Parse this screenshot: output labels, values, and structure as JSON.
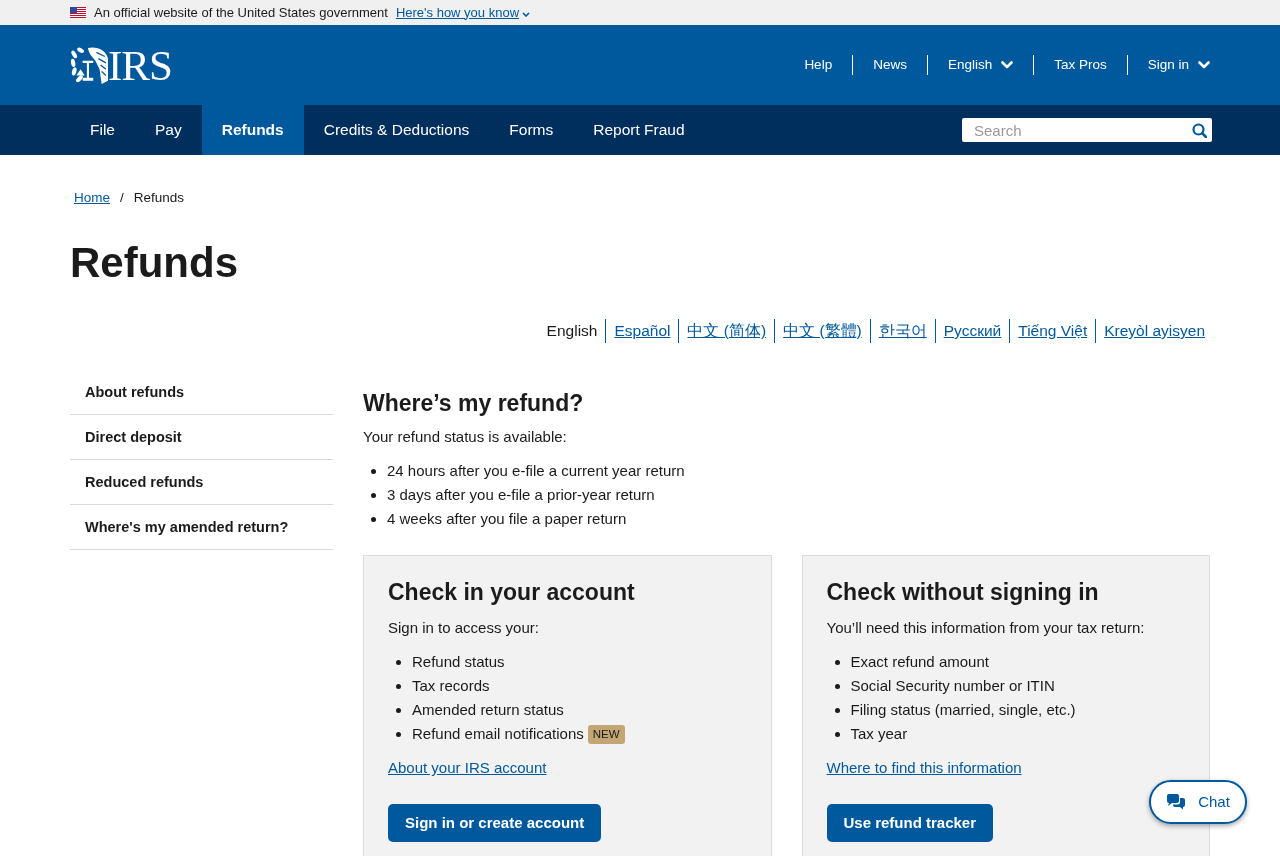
{
  "gov_banner": {
    "text": "An official website of the United States government",
    "link": "Here's how you know"
  },
  "header": {
    "logo": "IRS",
    "utility_nav": [
      {
        "label": "Help",
        "dropdown": false
      },
      {
        "label": "News",
        "dropdown": false
      },
      {
        "label": "English",
        "dropdown": true
      },
      {
        "label": "Tax Pros",
        "dropdown": false
      },
      {
        "label": "Sign in",
        "dropdown": true
      }
    ]
  },
  "main_nav": {
    "items": [
      {
        "label": "File",
        "selected": false
      },
      {
        "label": "Pay",
        "selected": false
      },
      {
        "label": "Refunds",
        "selected": true
      },
      {
        "label": "Credits & Deductions",
        "selected": false
      },
      {
        "label": "Forms",
        "selected": false
      },
      {
        "label": "Report Fraud",
        "selected": false
      }
    ],
    "search": {
      "placeholder": "Search"
    }
  },
  "breadcrumb": {
    "separator": "/",
    "items": [
      {
        "label": "Home",
        "kind": "link"
      },
      {
        "label": "Refunds",
        "kind": "current"
      }
    ]
  },
  "page_title": "Refunds",
  "languages": [
    {
      "label": "English",
      "selected": true
    },
    {
      "label": "Español",
      "selected": false
    },
    {
      "label": "中文 (简体)",
      "selected": false
    },
    {
      "label": "中文 (繁體)",
      "selected": false
    },
    {
      "label": "한국어",
      "selected": false
    },
    {
      "label": "Русский",
      "selected": false
    },
    {
      "label": "Tiếng Việt",
      "selected": false
    },
    {
      "label": "Kreyòl ayisyen",
      "selected": false
    }
  ],
  "sidebar": {
    "items": [
      {
        "label": "About refunds"
      },
      {
        "label": "Direct deposit"
      },
      {
        "label": "Reduced refunds"
      },
      {
        "label": "Where's my amended return?"
      }
    ]
  },
  "section": {
    "heading": "Where’s my refund?",
    "intro": "Your refund status is available:",
    "bullets": [
      "24 hours after you e-file a current year return",
      "3 days after you e-file a prior-year return",
      "4 weeks after you file a paper return"
    ]
  },
  "cards": [
    {
      "heading": "Check in your account",
      "intro": "Sign in to access your:",
      "items": [
        {
          "text": "Refund status"
        },
        {
          "text": "Tax records"
        },
        {
          "text": "Amended return status"
        },
        {
          "text": "Refund email notifications",
          "badge": "NEW"
        }
      ],
      "link": "About your IRS account",
      "button": "Sign in or create account"
    },
    {
      "heading": "Check without signing in",
      "intro": "You’ll need this information from your tax return:",
      "items": [
        {
          "text": "Exact refund amount"
        },
        {
          "text": "Social Security number or ITIN"
        },
        {
          "text": "Filing status (married, single, etc.)"
        },
        {
          "text": "Tax year"
        }
      ],
      "link": "Where to find this information",
      "button": "Use refund tracker"
    }
  ],
  "chat": {
    "label": "Chat"
  }
}
